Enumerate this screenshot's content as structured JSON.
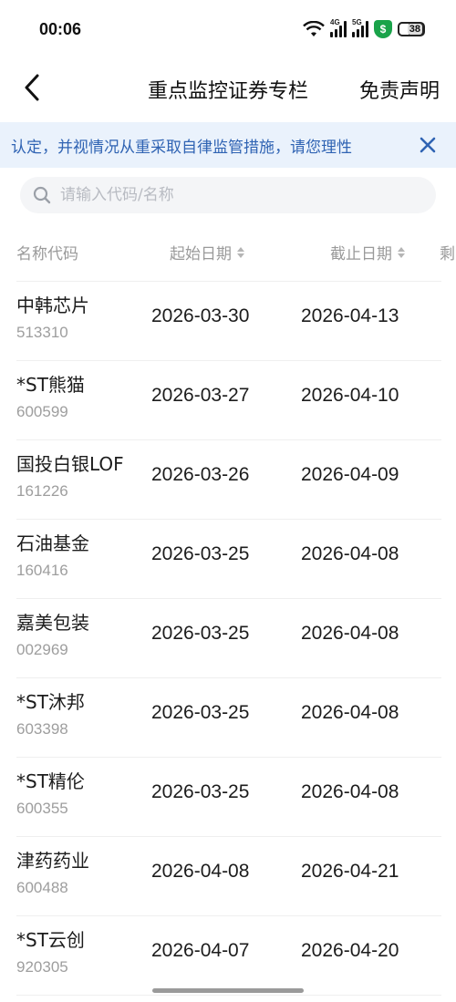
{
  "status_bar": {
    "time": "00:06",
    "net1": "4G",
    "net2": "5G",
    "shield_glyph": "$",
    "battery": "38"
  },
  "nav": {
    "title": "重点监控证券专栏",
    "disclaimer": "免责声明"
  },
  "notice": {
    "text": "认定，并视情况从重采取自律监管措施，请您理性"
  },
  "search": {
    "placeholder": "请输入代码/名称"
  },
  "table": {
    "headers": {
      "name": "名称代码",
      "start": "起始日期",
      "end": "截止日期",
      "more": "剩"
    },
    "rows": [
      {
        "name": "中韩芯片",
        "code": "513310",
        "start": "2026-03-30",
        "end": "2026-04-13"
      },
      {
        "name": "*ST熊猫",
        "code": "600599",
        "start": "2026-03-27",
        "end": "2026-04-10"
      },
      {
        "name": "国投白银LOF",
        "code": "161226",
        "start": "2026-03-26",
        "end": "2026-04-09"
      },
      {
        "name": "石油基金",
        "code": "160416",
        "start": "2026-03-25",
        "end": "2026-04-08"
      },
      {
        "name": "嘉美包装",
        "code": "002969",
        "start": "2026-03-25",
        "end": "2026-04-08"
      },
      {
        "name": "*ST沐邦",
        "code": "603398",
        "start": "2026-03-25",
        "end": "2026-04-08"
      },
      {
        "name": "*ST精伦",
        "code": "600355",
        "start": "2026-03-25",
        "end": "2026-04-08"
      },
      {
        "name": "津药药业",
        "code": "600488",
        "start": "2026-04-08",
        "end": "2026-04-21"
      },
      {
        "name": "*ST云创",
        "code": "920305",
        "start": "2026-04-07",
        "end": "2026-04-20"
      }
    ]
  },
  "colors": {
    "notice_bg": "#eaf2fc",
    "notice_text": "#2f63b3",
    "shield": "#1aa34a"
  }
}
